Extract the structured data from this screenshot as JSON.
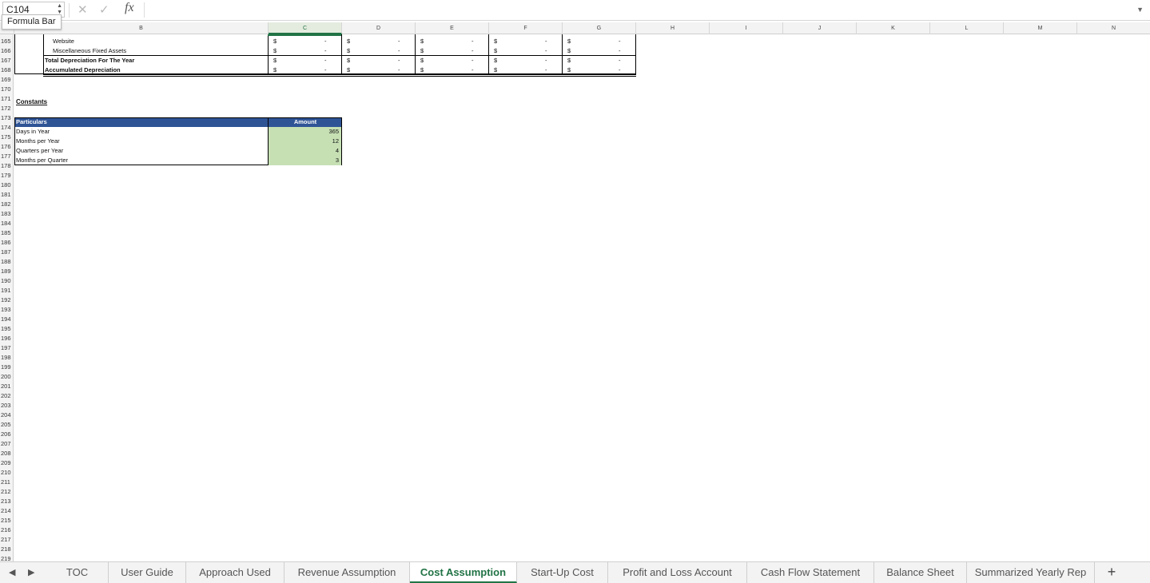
{
  "formula_bar": {
    "name_box": "C104",
    "fx_label": "fx",
    "tooltip": "Formula Bar",
    "cancel_glyph": "✕",
    "enter_glyph": "✓",
    "expand_glyph": "▼"
  },
  "columns": [
    "B",
    "C",
    "D",
    "E",
    "F",
    "G",
    "H",
    "I",
    "J",
    "K",
    "L",
    "M",
    "N"
  ],
  "active_column": "C",
  "rows": [
    "165",
    "166",
    "167",
    "168",
    "169",
    "170",
    "171",
    "172",
    "173",
    "174",
    "175",
    "176",
    "177",
    "178",
    "179",
    "180",
    "181",
    "182",
    "183",
    "184",
    "185",
    "186",
    "187",
    "188",
    "189",
    "190",
    "191",
    "192",
    "193",
    "194",
    "195",
    "196",
    "197",
    "198",
    "199",
    "200",
    "201",
    "202",
    "203",
    "204",
    "205",
    "206",
    "207",
    "208",
    "209",
    "210",
    "211",
    "212",
    "213",
    "214",
    "215",
    "216",
    "217",
    "218",
    "219"
  ],
  "depreciation": {
    "rows": [
      {
        "label": "Website"
      },
      {
        "label": "Miscellaneous Fixed Assets"
      },
      {
        "label": "Total Depreciation For The Year"
      },
      {
        "label": "Accumulated Depreciation"
      }
    ],
    "currency": "$",
    "value": "-"
  },
  "constants": {
    "title": "Constants",
    "header": {
      "particulars": "Particulars",
      "amount": "Amount"
    },
    "items": [
      {
        "label": "Days in Year",
        "amount": "365"
      },
      {
        "label": "Months per Year",
        "amount": "12"
      },
      {
        "label": "Quarters per Year",
        "amount": "4"
      },
      {
        "label": "Months per Quarter",
        "amount": "3"
      }
    ],
    "header_color": "#2f5496",
    "amount_fill": "#c6e0b4"
  },
  "sheet_tabs": [
    "TOC",
    "User Guide",
    "Approach Used",
    "Revenue Assumption",
    "Cost Assumption",
    "Start-Up Cost",
    "Profit and Loss Account",
    "Cash Flow Statement",
    "Balance Sheet",
    "Summarized Yearly Rep"
  ],
  "active_tab": "Cost Assumption",
  "accent_color": "#217346",
  "nav": {
    "prev": "◀",
    "next": "▶",
    "add": "+"
  }
}
